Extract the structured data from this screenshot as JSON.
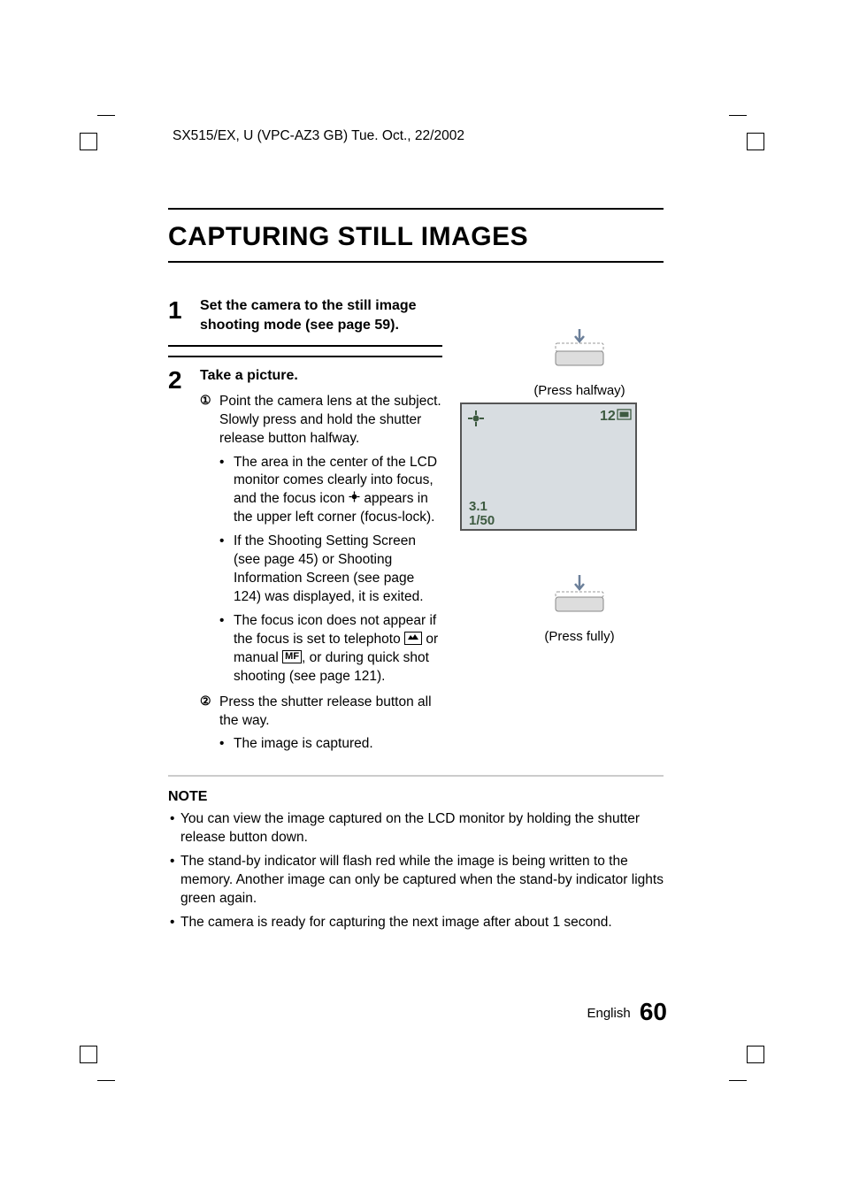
{
  "header": "SX515/EX, U (VPC-AZ3 GB)    Tue. Oct., 22/2002",
  "title": "CAPTURING STILL IMAGES",
  "step1": {
    "num": "1",
    "head": "Set the camera to the still image shooting mode (see page 59)."
  },
  "step2": {
    "num": "2",
    "head": "Take a picture.",
    "sub1_mark": "①",
    "sub1_text": "Point the camera lens at the subject. Slowly press and hold the shutter release button halfway.",
    "b1": "The area in the center of the LCD monitor comes clearly into focus, and the focus icon ",
    "b1_after": " appears in the upper left corner (focus-lock).",
    "b2": "If the Shooting Setting Screen (see page 45) or Shooting Information Screen (see page 124) was displayed, it is exited.",
    "b3_a": "The focus icon does not appear if the focus is set to telephoto ",
    "b3_b": " or manual ",
    "b3_c": ", or during quick shot shooting (see page 121).",
    "sub2_mark": "②",
    "sub2_text": "Press the shutter release button all the way.",
    "b4": "The image is captured."
  },
  "icons": {
    "telephoto_label": "▲▲",
    "mf_label": "MF"
  },
  "illus": {
    "half": "(Press halfway)",
    "full": "(Press fully)",
    "lcd_count": "12",
    "lcd_f": "3.1",
    "lcd_shutter": "1/50"
  },
  "note": {
    "head": "NOTE",
    "n1": "You can view the image captured on the LCD monitor by holding the shutter release button down.",
    "n2": "The stand-by indicator will flash red while the image is being written to the memory. Another image can only be captured when the stand-by indicator lights green again.",
    "n3": "The camera is ready for capturing the next image after about 1 second."
  },
  "footer": {
    "lang": "English",
    "page": "60"
  }
}
